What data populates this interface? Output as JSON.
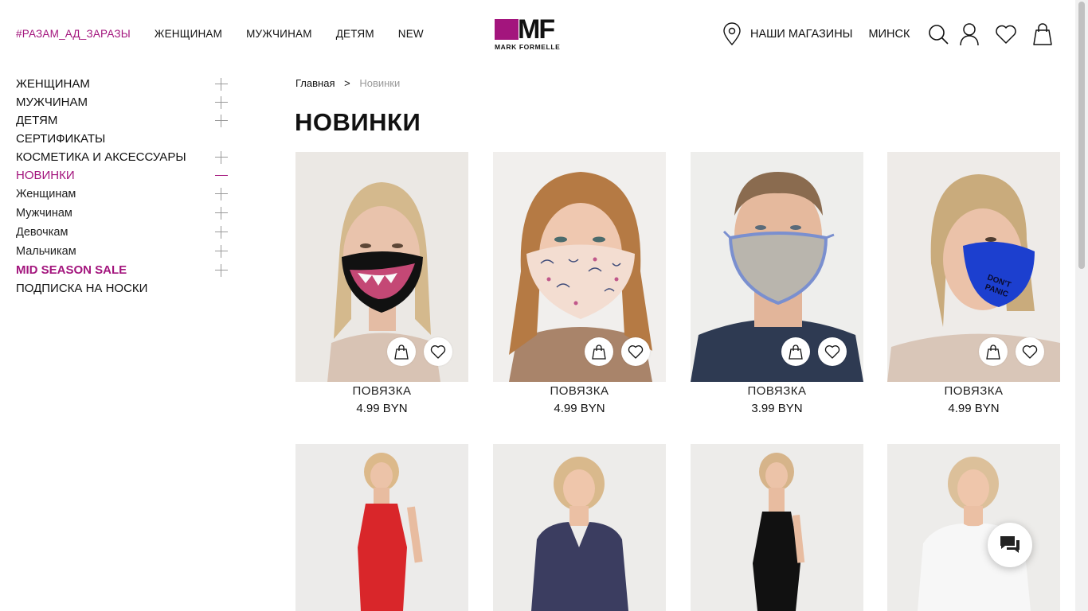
{
  "header": {
    "nav": [
      {
        "label": "#РАЗАМ_АД_ЗАРАЗЫ",
        "accent": true
      },
      {
        "label": "ЖЕНЩИНАМ"
      },
      {
        "label": "МУЖЧИНАМ"
      },
      {
        "label": "ДЕТЯМ"
      },
      {
        "label": "NEW"
      }
    ],
    "logo": {
      "mark": "MF",
      "text": "MARK FORMELLE"
    },
    "stores_label": "НАШИ МАГАЗИНЫ",
    "city": "МИНСК",
    "icons": [
      "location-pin-icon",
      "search-icon",
      "user-icon",
      "heart-icon",
      "shopping-bag-icon"
    ]
  },
  "colors": {
    "accent": "#a3157d"
  },
  "sidebar": {
    "items": [
      {
        "label": "ЖЕНЩИНАМ",
        "expand": "plus"
      },
      {
        "label": "МУЖЧИНАМ",
        "expand": "plus"
      },
      {
        "label": "ДЕТЯМ",
        "expand": "plus"
      },
      {
        "label": "СЕРТИФИКАТЫ",
        "expand": "none"
      },
      {
        "label": "КОСМЕТИКА И АКСЕССУАРЫ",
        "expand": "plus"
      },
      {
        "label": "НОВИНКИ",
        "expand": "minus",
        "active": true
      },
      {
        "label": "Женщинам",
        "expand": "plus",
        "sub": true
      },
      {
        "label": "Мужчинам",
        "expand": "plus",
        "sub": true
      },
      {
        "label": "Девочкам",
        "expand": "plus",
        "sub": true
      },
      {
        "label": "Мальчикам",
        "expand": "plus",
        "sub": true
      },
      {
        "label": "MID SEASON SALE",
        "expand": "plus",
        "sale": true
      },
      {
        "label": "ПОДПИСКА НА НОСКИ",
        "expand": "none"
      }
    ]
  },
  "breadcrumb": {
    "home": "Главная",
    "separator": ">",
    "current": "Новинки"
  },
  "page_title": "НОВИНКИ",
  "products": [
    {
      "name": "ПОВЯЗКА",
      "price": "4.99 BYN"
    },
    {
      "name": "ПОВЯЗКА",
      "price": "4.99 BYN"
    },
    {
      "name": "ПОВЯЗКА",
      "price": "3.99 BYN"
    },
    {
      "name": "ПОВЯЗКА",
      "price": "4.99 BYN"
    }
  ],
  "chat": {
    "icon": "chat-icon"
  }
}
